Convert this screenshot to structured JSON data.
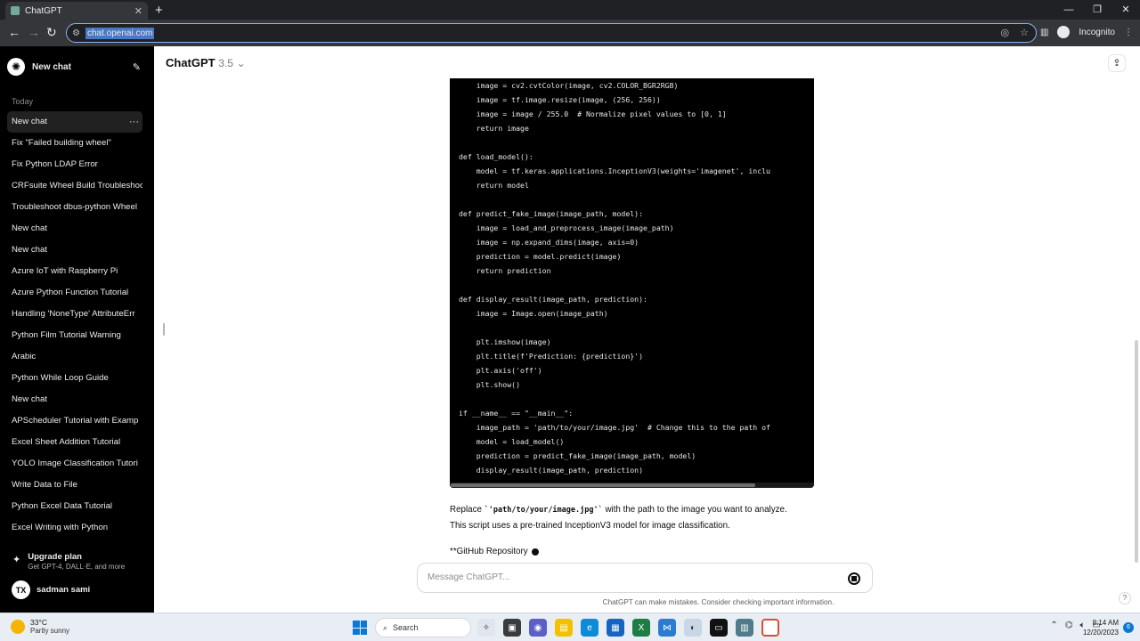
{
  "browser": {
    "tab_title": "ChatGPT",
    "url": "chat.openai.com",
    "profile_label": "Incognito"
  },
  "sidebar": {
    "new_chat_label": "New chat",
    "section_label": "Today",
    "items": [
      {
        "label": "New chat"
      },
      {
        "label": "Fix \"Failed building wheel\""
      },
      {
        "label": "Fix Python LDAP Error"
      },
      {
        "label": "CRFsuite Wheel Build Troubleshoo"
      },
      {
        "label": "Troubleshoot dbus-python Wheel"
      },
      {
        "label": "New chat"
      },
      {
        "label": "New chat"
      },
      {
        "label": "Azure IoT with Raspberry Pi"
      },
      {
        "label": "Azure Python Function Tutorial"
      },
      {
        "label": "Handling 'NoneType' AttributeErr"
      },
      {
        "label": "Python Film Tutorial Warning"
      },
      {
        "label": "Arabic"
      },
      {
        "label": "Python While Loop Guide"
      },
      {
        "label": "New chat"
      },
      {
        "label": "APScheduler Tutorial with Examp"
      },
      {
        "label": "Excel Sheet Addition Tutorial"
      },
      {
        "label": "YOLO Image Classification Tutori"
      },
      {
        "label": "Write Data to File"
      },
      {
        "label": "Python Excel Data Tutorial"
      },
      {
        "label": "Excel Writing with Python"
      }
    ],
    "upgrade_title": "Upgrade plan",
    "upgrade_sub": "Get GPT-4, DALL·E, and more",
    "avatar_initials": "TX",
    "user_name": "sadman sami"
  },
  "main": {
    "model_name": "ChatGPT",
    "model_version": "3.5",
    "code_lines": [
      "    image = cv2.cvtColor(image, cv2.COLOR_BGR2RGB)",
      "    image = tf.image.resize(image, (256, 256))",
      "    image = image / 255.0  # Normalize pixel values to [0, 1]",
      "    return image",
      "",
      "def load_model():",
      "    model = tf.keras.applications.InceptionV3(weights='imagenet', inclu",
      "    return model",
      "",
      "def predict_fake_image(image_path, model):",
      "    image = load_and_preprocess_image(image_path)",
      "    image = np.expand_dims(image, axis=0)",
      "    prediction = model.predict(image)",
      "    return prediction",
      "",
      "def display_result(image_path, prediction):",
      "    image = Image.open(image_path)",
      "",
      "    plt.imshow(image)",
      "    plt.title(f'Prediction: {prediction}')",
      "    plt.axis('off')",
      "    plt.show()",
      "",
      "if __name__ == \"__main__\":",
      "    image_path = 'path/to/your/image.jpg'  # Change this to the path of",
      "    model = load_model()",
      "    prediction = predict_fake_image(image_path, model)",
      "    display_result(image_path, prediction)"
    ],
    "answer_prefix": "Replace ",
    "answer_code": "`'path/to/your/image.jpg'`",
    "answer_suffix": " with the path to the image you want to analyze.",
    "answer_line2": "This script uses a pre-trained InceptionV3 model for image classification.",
    "github_text": "**GitHub Repository",
    "composer_placeholder": "Message ChatGPT...",
    "disclaimer": "ChatGPT can make mistakes. Consider checking important information.",
    "help_label": "?"
  },
  "taskbar": {
    "temp": "33°C",
    "weather_desc": "Partly sunny",
    "search_label": "Search",
    "time": "8:14 AM",
    "date": "12/20/2023",
    "notification_count": "6"
  },
  "colors": {
    "sidebar_bg": "#000000",
    "code_bg": "#000000",
    "accent_blue": "#8ab4f8"
  }
}
